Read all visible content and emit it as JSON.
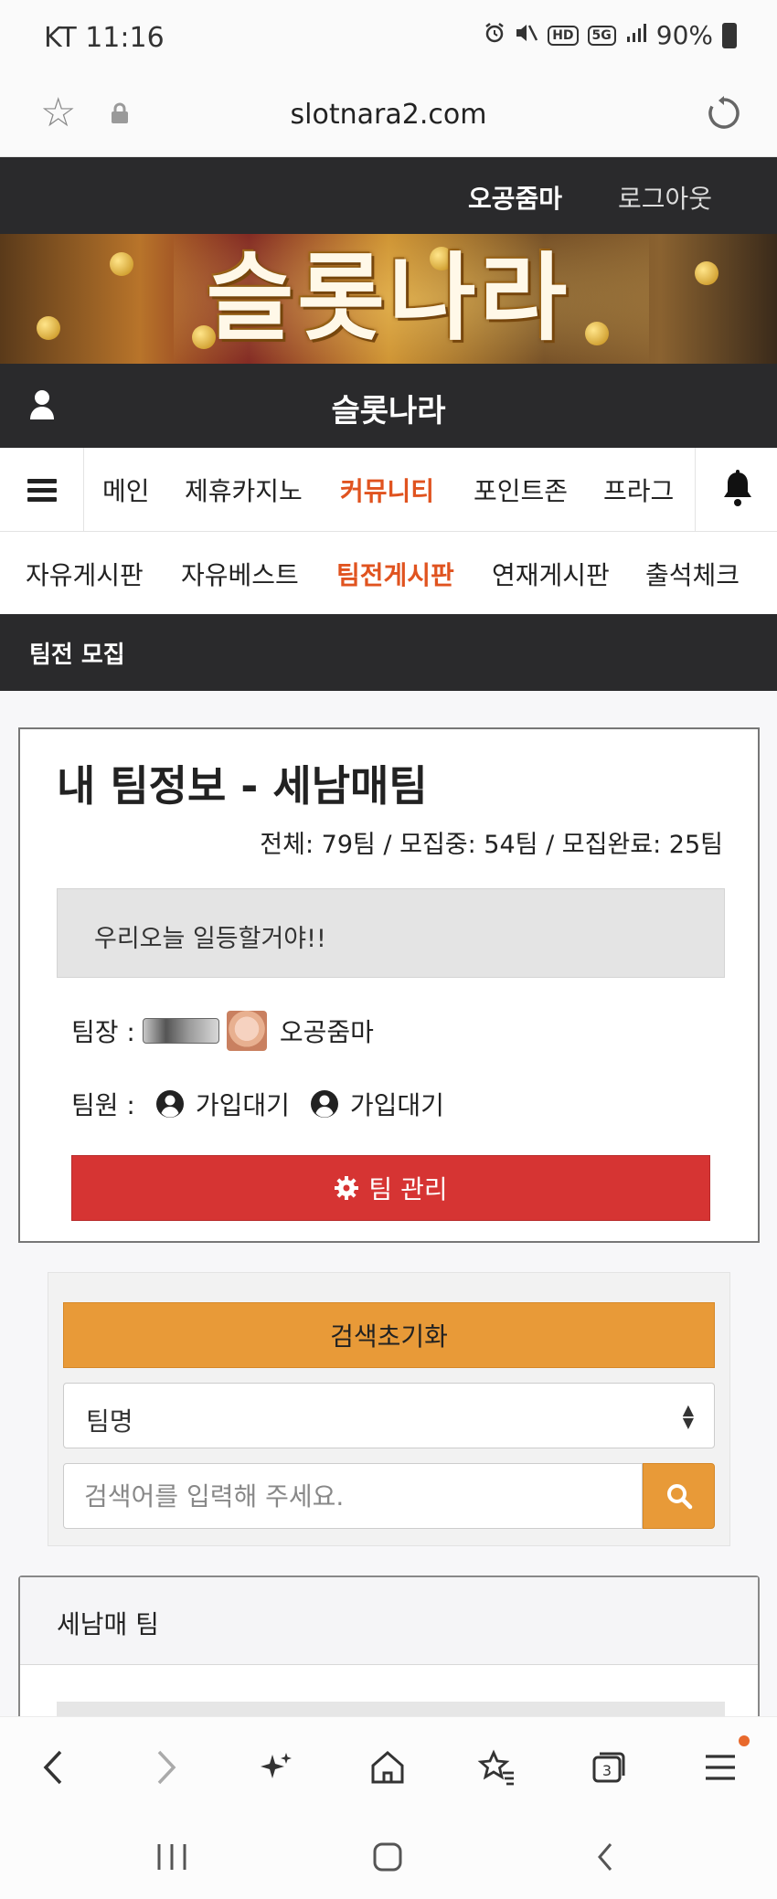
{
  "status_bar": {
    "carrier_time": "KT 11:16",
    "battery": "90%",
    "icons": [
      "alarm-icon",
      "mute-icon",
      "hd-icon",
      "5g-icon",
      "signal-icon",
      "battery-icon"
    ],
    "hd_label": "HD",
    "net_label": "5G"
  },
  "browser": {
    "url": "slotnara2.com"
  },
  "header": {
    "user_name": "오공줌마",
    "logout": "로그아웃",
    "banner_title": "슬롯나라",
    "site_name": "슬롯나라"
  },
  "main_nav": {
    "items": [
      {
        "label": "메인"
      },
      {
        "label": "제휴카지노"
      },
      {
        "label": "커뮤니티"
      },
      {
        "label": "포인트존"
      },
      {
        "label": "프라그"
      }
    ],
    "active_index": 2
  },
  "sub_nav": {
    "items": [
      {
        "label": "자유게시판"
      },
      {
        "label": "자유베스트"
      },
      {
        "label": "팀전게시판"
      },
      {
        "label": "연재게시판"
      },
      {
        "label": "출석체크"
      }
    ],
    "active_index": 2
  },
  "section": {
    "title": "팀전 모집"
  },
  "team_info": {
    "title": "내 팀정보 - 세남매팀",
    "stats": "전체: 79팀 / 모집중: 54팀 / 모집완료: 25팀",
    "message": "우리오늘 일등할거야!!",
    "leader_label": "팀장 :",
    "leader_name": "오공줌마",
    "members_label": "팀원 :",
    "members": [
      {
        "status": "가입대기"
      },
      {
        "status": "가입대기"
      }
    ],
    "manage_button": "팀 관리"
  },
  "search": {
    "reset_button": "검색초기화",
    "select_value": "팀명",
    "placeholder": "검색어를 입력해 주세요."
  },
  "team_list": {
    "header": "세남매 팀"
  },
  "colors": {
    "dark_bar": "#2a2a2c",
    "accent_active": "#e0531f",
    "manage_red": "#d63433",
    "search_orange": "#e89a38"
  }
}
